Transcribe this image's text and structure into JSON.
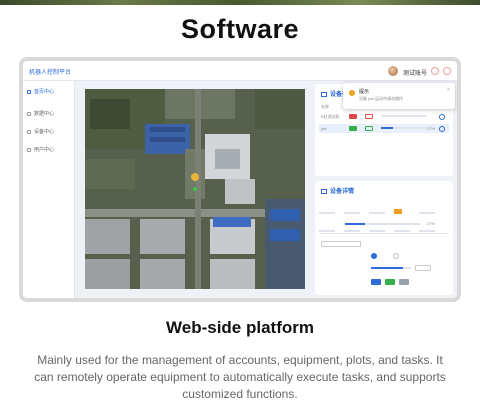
{
  "headline": "Software",
  "app": {
    "title": "机器人控制平台",
    "username": "测试账号",
    "sidebar_items": [
      "首页中心",
      "数据中心",
      "设备中心",
      "用户中心"
    ]
  },
  "notification": {
    "title": "提示",
    "message": "设备 jxw 运动中请勿操作",
    "close": "×"
  },
  "device_list": {
    "title": "设备列表",
    "columns": [
      "名称",
      "状态",
      "电量",
      "进度",
      "",
      "",
      "操作"
    ],
    "rows": [
      {
        "name": "K杠测试机",
        "percent": ""
      },
      {
        "name": "jxw",
        "percent": "27%"
      }
    ]
  },
  "device_detail": {
    "title": "设备详情",
    "percent": "27%"
  },
  "subtitle": "Web-side platform",
  "description": "Mainly used for the management of accounts, equipment, plots, and tasks. It can remotely operate equipment to automatically execute tasks, and supports customized functions.",
  "colors": {
    "accent": "#2e6bd8",
    "warning": "#f0a020",
    "danger": "#e04848",
    "success": "#36b04a"
  }
}
